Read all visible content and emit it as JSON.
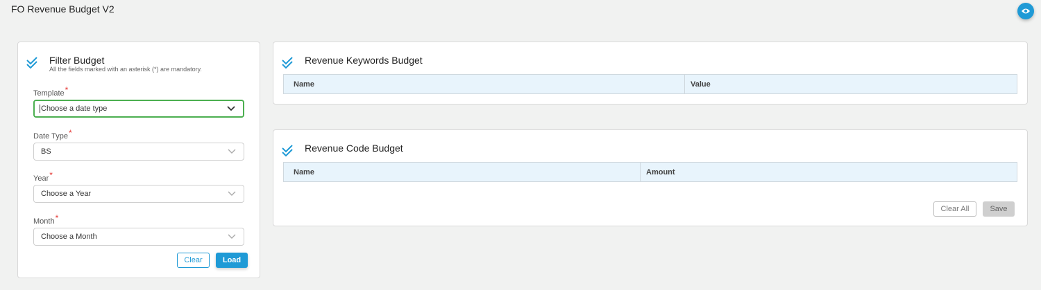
{
  "page": {
    "title": "FO Revenue Budget V2"
  },
  "filter_card": {
    "title": "Filter Budget",
    "subtitle": "All the fields marked with an asterisk (*) are mandatory.",
    "fields": {
      "template": {
        "label": "Template",
        "required": "*",
        "placeholder": "Choose a date type"
      },
      "date_type": {
        "label": "Date Type",
        "required": "*",
        "value": "BS"
      },
      "year": {
        "label": "Year",
        "required": "*",
        "placeholder": "Choose a Year"
      },
      "month": {
        "label": "Month",
        "required": "*",
        "placeholder": "Choose a Month"
      }
    },
    "buttons": {
      "clear": "Clear",
      "load": "Load"
    }
  },
  "keywords_card": {
    "title": "Revenue Keywords Budget",
    "columns": [
      "Name",
      "Value"
    ]
  },
  "codes_card": {
    "title": "Revenue Code Budget",
    "columns": [
      "Name",
      "Amount"
    ],
    "buttons": {
      "clear_all": "Clear All",
      "save": "Save"
    }
  },
  "colors": {
    "accent": "#1f9ad6",
    "focus_border": "#4caf50",
    "required": "#e53935",
    "table_header_bg": "#e8f4fc"
  },
  "icons": {
    "view_toggle": "eye-icon",
    "card_header": "double-check-icon",
    "select_arrow": "chevron-down-icon"
  }
}
